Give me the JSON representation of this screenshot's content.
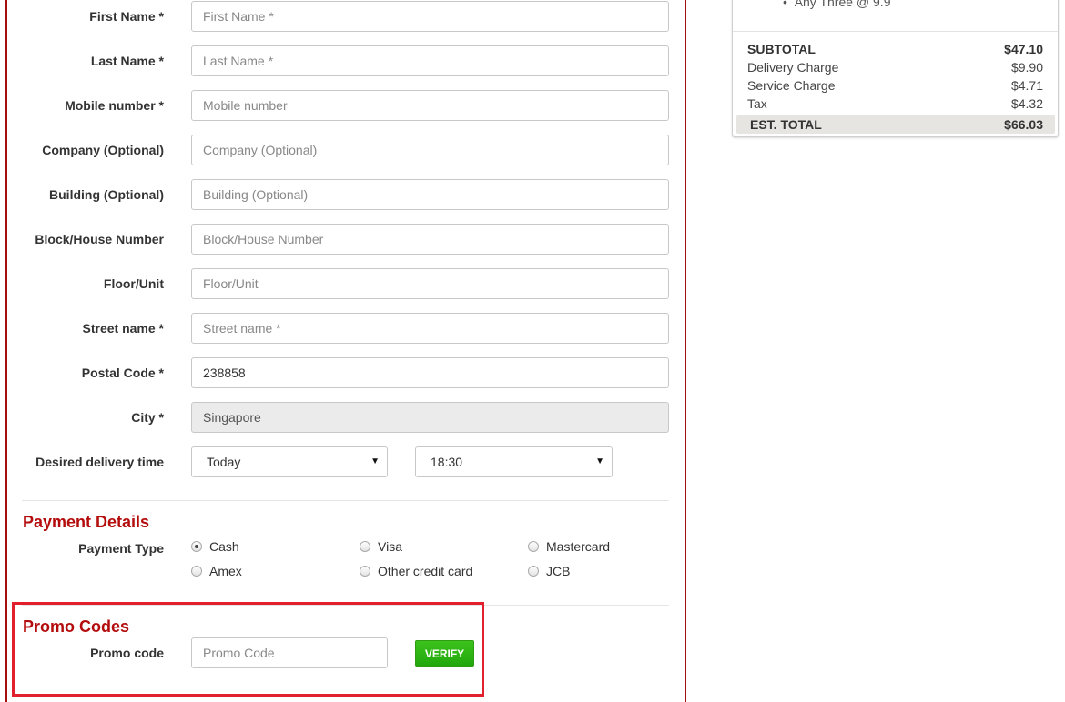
{
  "form": {
    "fields": [
      {
        "label": "First Name *",
        "placeholder": "First Name *",
        "value": ""
      },
      {
        "label": "Last Name *",
        "placeholder": "Last Name *",
        "value": ""
      },
      {
        "label": "Mobile number *",
        "placeholder": "Mobile number",
        "value": ""
      },
      {
        "label": "Company (Optional)",
        "placeholder": "Company (Optional)",
        "value": ""
      },
      {
        "label": "Building (Optional)",
        "placeholder": "Building (Optional)",
        "value": ""
      },
      {
        "label": "Block/House Number",
        "placeholder": "Block/House Number",
        "value": ""
      },
      {
        "label": "Floor/Unit",
        "placeholder": "Floor/Unit",
        "value": ""
      },
      {
        "label": "Street name *",
        "placeholder": "Street name *",
        "value": ""
      },
      {
        "label": "Postal Code *",
        "placeholder": "",
        "value": "238858"
      },
      {
        "label": "City *",
        "placeholder": "",
        "value": "Singapore"
      }
    ],
    "delivery": {
      "label": "Desired delivery time",
      "day": "Today",
      "time": "18:30"
    }
  },
  "payment": {
    "title": "Payment Details",
    "type_label": "Payment Type",
    "options": [
      "Cash",
      "Visa",
      "Mastercard",
      "Amex",
      "Other credit card",
      "JCB"
    ],
    "selected": "Cash"
  },
  "promo": {
    "title": "Promo Codes",
    "label": "Promo code",
    "placeholder": "Promo Code",
    "button": "VERIFY",
    "highlight_color": "#e21f2c"
  },
  "summary": {
    "truncated_item": "Any Three @ 9.9",
    "subtotal": {
      "label": "SUBTOTAL",
      "value": "$47.10"
    },
    "lines": [
      {
        "label": "Delivery Charge",
        "value": "$9.90"
      },
      {
        "label": "Service Charge",
        "value": "$4.71"
      },
      {
        "label": "Tax",
        "value": "$4.32"
      }
    ],
    "total": {
      "label": "EST. TOTAL",
      "value": "$66.03"
    }
  },
  "colors": {
    "accent": "#b40d0d",
    "verify": "#22a80c"
  }
}
